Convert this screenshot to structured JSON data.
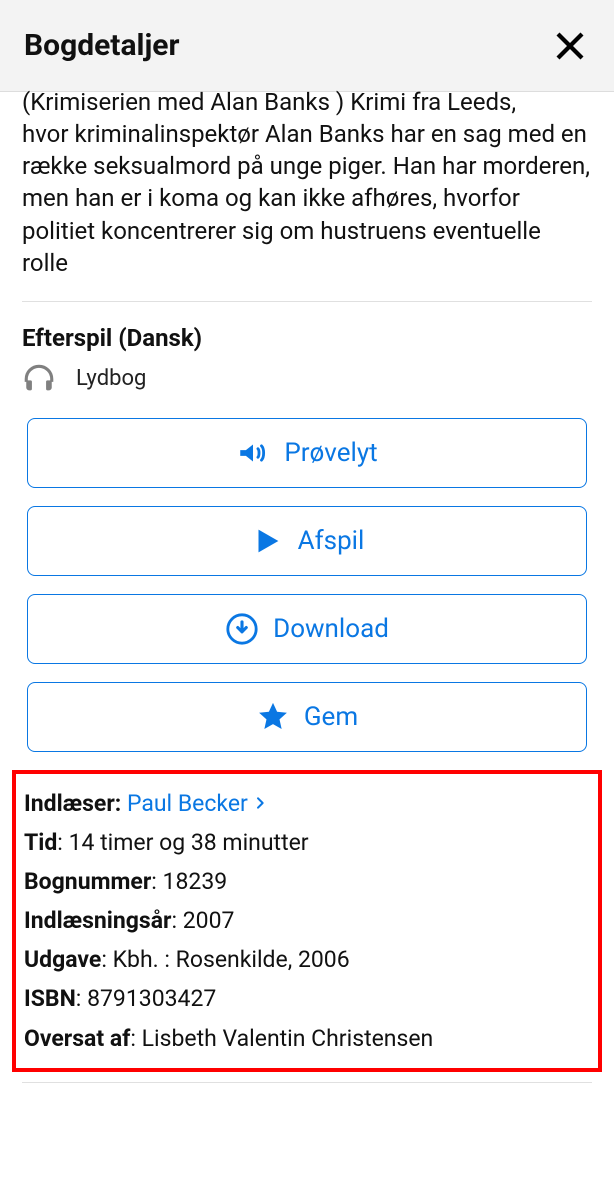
{
  "header": {
    "title": "Bogdetaljer"
  },
  "description": {
    "prev_line": "(Krimiserien med Alan Banks ) Krimi fra Leeds,",
    "body": "hvor kriminalinspektør Alan Banks har en sag med en række seksualmord på unge piger. Han har morderen, men han er i koma og kan ikke afhøres, hvorfor politiet koncentrerer sig om hustruens eventuelle rolle"
  },
  "section": {
    "title": "Efterspil (Dansk)",
    "media_label": "Lydbog"
  },
  "actions": {
    "preview": "Prøvelyt",
    "play": "Afspil",
    "download": "Download",
    "save": "Gem"
  },
  "meta": {
    "narrator_label": "Indlæser",
    "narrator_value": "Paul Becker",
    "time_label": "Tid",
    "time_value": "14 timer og 38 minutter",
    "booknum_label": "Bognummer",
    "booknum_value": "18239",
    "recyear_label": "Indlæsningsår",
    "recyear_value": "2007",
    "edition_label": "Udgave",
    "edition_value": "Kbh. : Rosenkilde, 2006",
    "isbn_label": "ISBN",
    "isbn_value": "8791303427",
    "translator_label": "Oversat af",
    "translator_value": "Lisbeth Valentin Christensen"
  }
}
